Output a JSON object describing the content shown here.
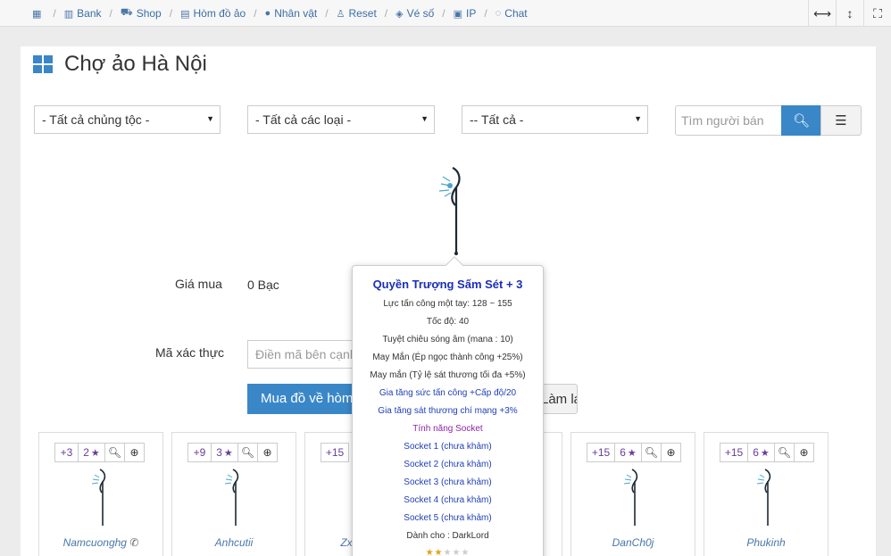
{
  "breadcrumbs": [
    {
      "icon": "calendar-icon",
      "label": ""
    },
    {
      "icon": "bank-icon",
      "label": "Bank"
    },
    {
      "icon": "cart-icon",
      "label": "Shop"
    },
    {
      "icon": "briefcase-icon",
      "label": "Hòm đồ ảo"
    },
    {
      "icon": "user-icon",
      "label": "Nhân vật"
    },
    {
      "icon": "reset-icon",
      "label": "Reset"
    },
    {
      "icon": "ticket-icon",
      "label": "Vé số"
    },
    {
      "icon": "lock-icon",
      "label": "IP"
    },
    {
      "icon": "chat-icon",
      "label": "Chat"
    }
  ],
  "page": {
    "title": "Chợ ảo Hà Nội"
  },
  "filters": {
    "race": "- Tất cả chủng tộc -",
    "type": "- Tất cả các loại -",
    "all": "-- Tất cả -",
    "search_placeholder": "Tìm người bán"
  },
  "form": {
    "price_label": "Giá mua",
    "price_value": "0 Bạc",
    "captcha_label": "Mã xác thực",
    "captcha_placeholder": "Điền mã bên cạnh",
    "buy_label": "Mua đồ về hòm",
    "reset_label": "Làm lại"
  },
  "tooltip": {
    "title": "Quyền Trượng Sấm Sét + 3",
    "lines": [
      {
        "text": "Lực tấn công một tay: 128 ~ 155",
        "color": "#333333"
      },
      {
        "text": "Tốc độ: 40",
        "color": "#333333"
      },
      {
        "text": "Tuyệt chiêu sóng âm (mana : 10)",
        "color": "#333333"
      },
      {
        "text": "May Mắn (Ép ngọc thành công +25%)",
        "color": "#333333"
      },
      {
        "text": "May mắn (Tỷ lệ sát thương tối đa +5%)",
        "color": "#333333"
      },
      {
        "text": "Gia tăng sức tấn công +Cấp độ/20",
        "color": "#1f3fb8"
      },
      {
        "text": "Gia tăng sát thương chí mạng +3%",
        "color": "#1f3fb8"
      },
      {
        "text": "Tính năng Socket",
        "color": "#8e24aa"
      },
      {
        "text": "Socket 1 (chưa khảm)",
        "color": "#1f3fb8"
      },
      {
        "text": "Socket 2 (chưa khảm)",
        "color": "#1f3fb8"
      },
      {
        "text": "Socket 3 (chưa khảm)",
        "color": "#1f3fb8"
      },
      {
        "text": "Socket 4 (chưa khảm)",
        "color": "#1f3fb8"
      },
      {
        "text": "Socket 5 (chưa khảm)",
        "color": "#1f3fb8"
      },
      {
        "text": "Dành cho : DarkLord",
        "color": "#333333"
      }
    ],
    "stars_filled": 2,
    "stars_total": 5
  },
  "items": [
    {
      "level": "+3",
      "excellent": "2",
      "seller": "Namcuonghg",
      "has_phone": true
    },
    {
      "level": "+9",
      "excellent": "3",
      "seller": "Anhcutii",
      "has_phone": false
    },
    {
      "level": "+15",
      "excellent": "",
      "seller": "Zxc",
      "has_phone": false
    },
    {
      "level": "",
      "excellent": "",
      "seller": "",
      "has_phone": false
    },
    {
      "level": "+15",
      "excellent": "6",
      "seller": "DanCh0j",
      "has_phone": false
    },
    {
      "level": "+15",
      "excellent": "6",
      "seller": "Phukinh",
      "has_phone": false
    }
  ],
  "colors": {
    "accent": "#3a87c8",
    "link": "#4a76a8",
    "tooltip_title": "#1a2fb8"
  }
}
